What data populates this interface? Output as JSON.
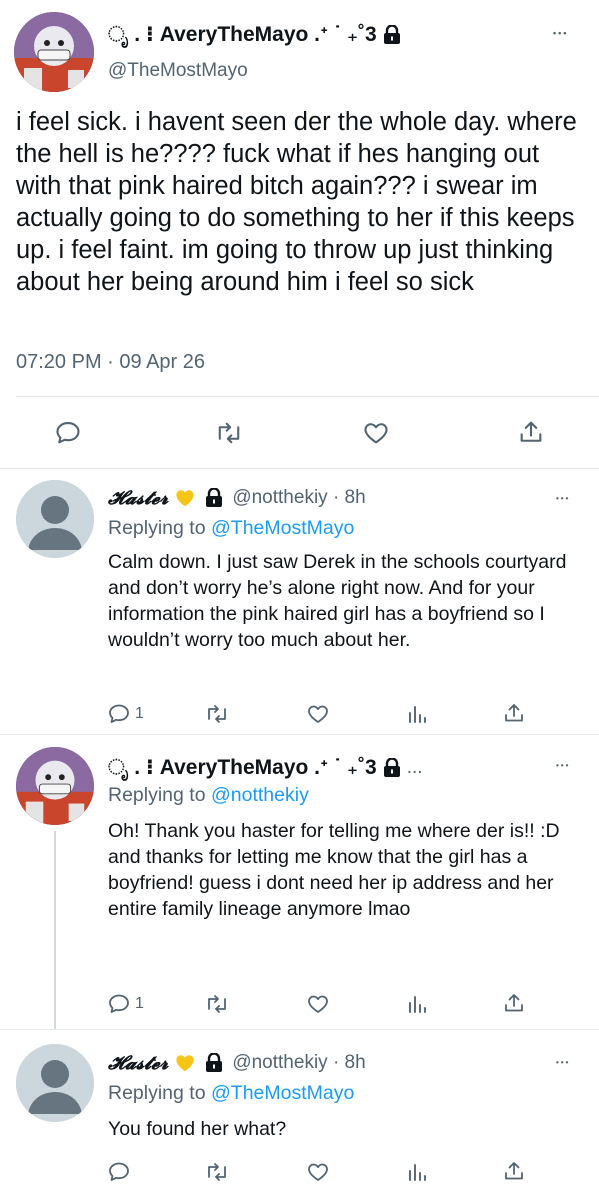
{
  "main_tweet": {
    "display_name": "ೃ . ⁝ AveryTheMayo .ᐩ ˙ ₊˚3",
    "handle": "@TheMostMayo",
    "text": "i feel sick. i havent seen der the whole day. where the hell is he???? fuck what if hes hanging out with that pink haired bitch again??? i swear im actually going to do something to her if this keeps up. i feel faint. im going to throw up just thinking about her being around him i feel so sick",
    "timestamp": "07:20 PM · 09 Apr 26",
    "more_label": "•••"
  },
  "replies": [
    {
      "display_name": "𝓗𝓪𝓼𝓽𝓮𝓻",
      "handle_time": "@notthekiy · 8h",
      "replying_prefix": "Replying to",
      "replying_to": "@TheMostMayo",
      "text": "Calm down. I just saw Derek in the schools courtyard and don’t worry he’s alone right now. And for your information the pink haired girl has a boyfriend so I wouldn’t worry too much about her.",
      "reply_count": "1",
      "more_label": "•••"
    },
    {
      "display_name": "ೃ . ⁝ AveryTheMayo .ᐩ ˙ ₊˚3",
      "handle_time": "...",
      "replying_prefix": "Replying to",
      "replying_to": "@notthekiy",
      "text": "Oh! Thank you haster for telling me where der is!! :D\nand thanks for letting me know that the girl has a boyfriend! guess i dont need her ip address and her entire family lineage anymore lmao",
      "reply_count": "1",
      "more_label": "•••"
    },
    {
      "display_name": "𝓗𝓪𝓼𝓽𝓮𝓻",
      "handle_time": "@notthekiy · 8h",
      "replying_prefix": "Replying to",
      "replying_to": "@TheMostMayo",
      "text": "You found her what?",
      "reply_count": "",
      "more_label": "•••"
    }
  ],
  "icons": {
    "reply": "reply-icon",
    "retweet": "retweet-icon",
    "like": "heart-icon",
    "share": "share-icon",
    "analytics": "analytics-icon",
    "lock": "lock-icon",
    "heart_emoji": "yellow-heart-icon",
    "more": "more-icon"
  },
  "colors": {
    "link": "#1d9bf0",
    "muted": "#536471",
    "text": "#0f1419",
    "yellow_heart": "#f5c518"
  }
}
